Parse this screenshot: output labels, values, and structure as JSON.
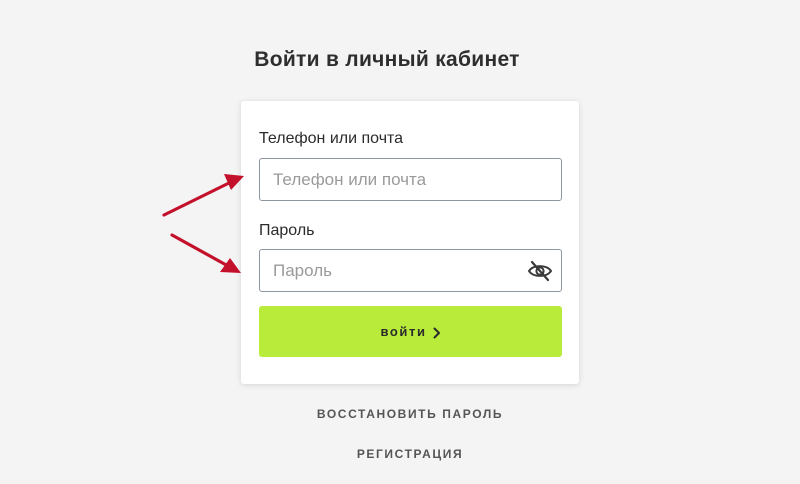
{
  "page": {
    "title": "Войти в личный кабинет"
  },
  "login_form": {
    "login_label": "Телефон или почта",
    "login_placeholder": "Телефон или почта",
    "login_value": "",
    "password_label": "Пароль",
    "password_placeholder": "Пароль",
    "password_value": "",
    "password_toggle_icon": "eye-off-icon",
    "submit_label": "войти",
    "submit_icon": "chevron-right-icon"
  },
  "links": {
    "restore_password": "ВОССТАНОВИТЬ ПАРОЛЬ",
    "register": "РЕГИСТРАЦИЯ"
  },
  "colors": {
    "background": "#f4f4f4",
    "accent_button": "#b8eb3a",
    "annotation_arrow": "#c4112b",
    "input_border": "#8e96a3"
  }
}
